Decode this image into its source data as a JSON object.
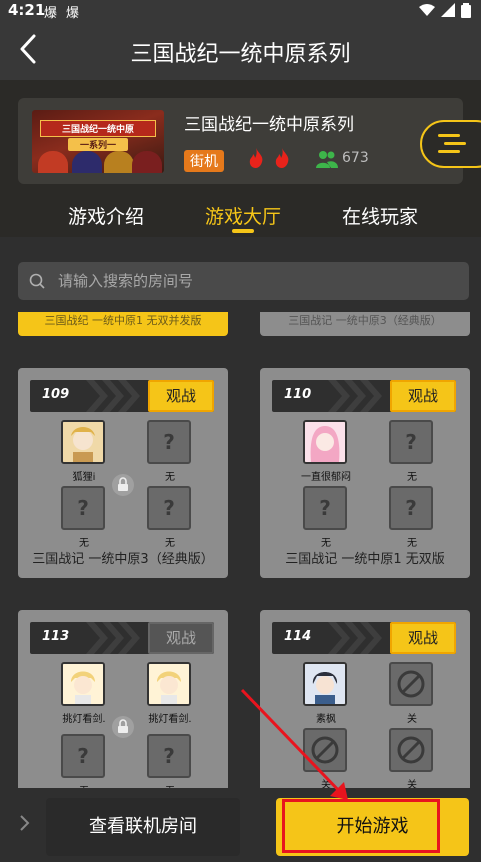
{
  "status_bar": {
    "time": "4:21",
    "notif_icons": [
      "爆",
      "爆"
    ]
  },
  "header": {
    "title": "三国战纪一统中原系列"
  },
  "game": {
    "thumb_title": "三国战纪一统中原",
    "thumb_subtitle": "一系列一",
    "name": "三国战纪一统中原系列",
    "tag": "街机",
    "players": "673"
  },
  "tabs": [
    "游戏介绍",
    "游戏大厅",
    "在线玩家"
  ],
  "search": {
    "placeholder": "请输入搜索的房间号"
  },
  "partial_rooms": [
    "三国战纪 一统中原1 无双并发版",
    "三国战记 一统中原3（经典版）"
  ],
  "rooms": [
    {
      "num": "109",
      "watch": "观战",
      "seats": [
        "狐狸i",
        "无",
        "无",
        "无"
      ],
      "name": "三国战记 一统中原3（经典版）"
    },
    {
      "num": "110",
      "watch": "观战",
      "seats": [
        "一直很郁闷",
        "无",
        "无",
        "无"
      ],
      "name": "三国战记 一统中原1 无双版"
    },
    {
      "num": "113",
      "watch": "观战",
      "seats": [
        "挑灯看剑.",
        "挑灯看剑.",
        "无",
        "无"
      ],
      "name": ""
    },
    {
      "num": "114",
      "watch": "观战",
      "seats": [
        "素枫",
        "关",
        "关",
        "关"
      ],
      "name": ""
    }
  ],
  "bottom": {
    "view_rooms": "查看联机房间",
    "start_game": "开始游戏"
  },
  "colors": {
    "accent": "#f5c518",
    "highlight": "#e8141e",
    "tag": "#e5791b"
  }
}
